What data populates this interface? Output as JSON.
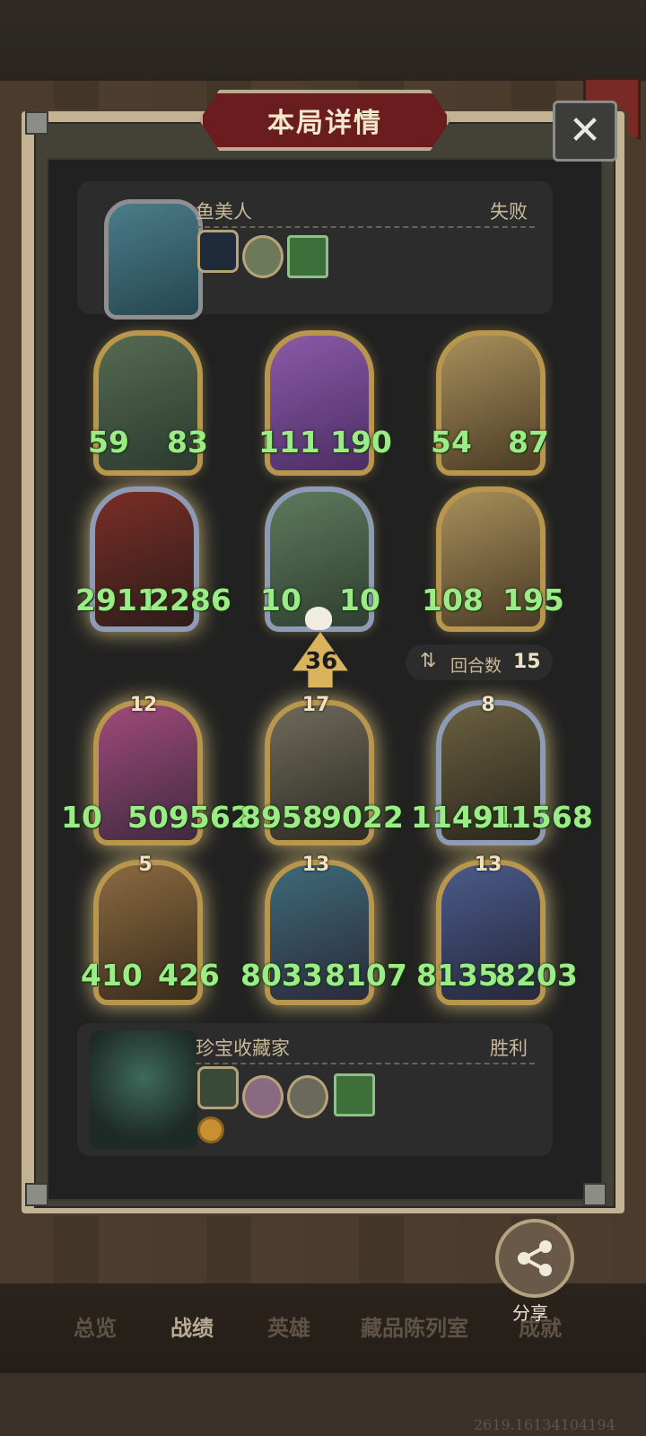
{
  "title": "本局详情",
  "close_icon": "close-icon",
  "opponent": {
    "name": "鱼美人",
    "result": "失败"
  },
  "player": {
    "name": "珍宝收藏家",
    "result": "胜利"
  },
  "opponent_board": [
    {
      "attack": "59",
      "health": "83"
    },
    {
      "attack": "111",
      "health": "190"
    },
    {
      "attack": "54",
      "health": "87"
    },
    {
      "attack": "2911",
      "health": "2286"
    },
    {
      "attack": "10",
      "health": "10"
    },
    {
      "attack": "108",
      "health": "195"
    }
  ],
  "player_board": [
    {
      "level": "12",
      "attack": "10",
      "health": "509562",
      "attack_partial": "1",
      "sep": ""
    },
    {
      "level": "17",
      "attack": "8958",
      "health": "9022"
    },
    {
      "level": "8",
      "attack": "11491",
      "health": "11568"
    },
    {
      "level": "5",
      "attack": "410",
      "health": "426"
    },
    {
      "level": "13",
      "attack": "8033",
      "health": "8107"
    },
    {
      "level": "13",
      "attack": "8135",
      "health": "8203"
    }
  ],
  "damage": "36",
  "turns": {
    "label": "回合数",
    "value": "15"
  },
  "share_label": "分享",
  "tabs": [
    "总览",
    "战绩",
    "英雄",
    "藏品陈列室",
    "成就"
  ],
  "build_number": "2619.16134104194",
  "colors": {
    "stat_green": "#9bec86",
    "banner_red": "#6a1c1e",
    "gold_border": "#b9964d"
  }
}
